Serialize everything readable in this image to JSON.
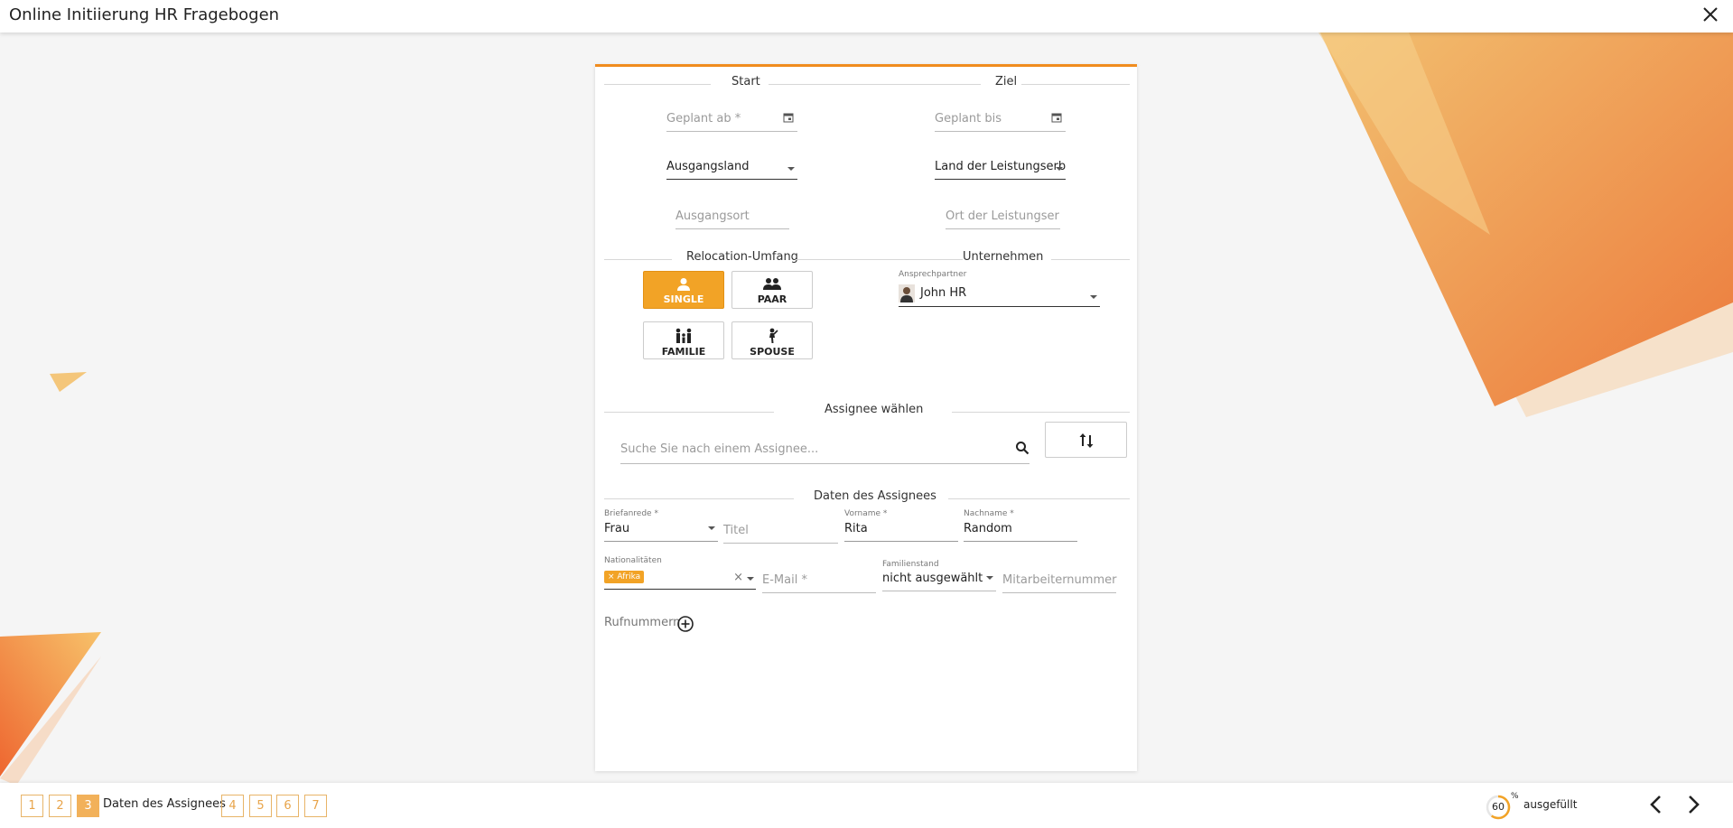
{
  "window": {
    "title": "Online Initiierung HR Fragebogen"
  },
  "sections": {
    "start": "Start",
    "ziel": "Ziel",
    "relocation": "Relocation-Umfang",
    "unternehmen": "Unternehmen",
    "assignee_select": "Assignee wählen",
    "assignee_data": "Daten des Assignees"
  },
  "start": {
    "planned_from": "Geplant ab *",
    "origin_country": "Ausgangsland",
    "origin_place": "Ausgangsort"
  },
  "ziel": {
    "planned_to": "Geplant bis",
    "service_country": "Land der Leistungserbringung",
    "service_place": "Ort der Leistungserb..."
  },
  "scope": {
    "options": [
      "SINGLE",
      "PAAR",
      "FAMILIE",
      "SPOUSE"
    ],
    "selected": "SINGLE"
  },
  "company": {
    "contact_label": "Ansprechpartner",
    "contact_value": "John HR"
  },
  "search": {
    "placeholder": "Suche Sie nach einem Assignee..."
  },
  "assignee": {
    "salutation_label": "Briefanrede *",
    "salutation_value": "Frau",
    "title_placeholder": "Titel",
    "firstname_label": "Vorname *",
    "firstname_value": "Rita",
    "lastname_label": "Nachname *",
    "lastname_value": "Random",
    "nationality_label": "Nationalitäten",
    "nationality_chip": "Afrika",
    "email_placeholder": "E-Mail *",
    "marital_label": "Familienstand",
    "marital_value": "nicht ausgewählt",
    "employee_placeholder": "Mitarbeiternummer",
    "phones_label": "Rufnummern"
  },
  "footer": {
    "steps": [
      "1",
      "2",
      "3",
      "4",
      "5",
      "6",
      "7"
    ],
    "active_step": "3",
    "active_step_label": "Daten des Assignees",
    "progress_value": "60",
    "progress_unit": "%",
    "progress_text": "ausgefüllt",
    "progress_fraction": 0.6
  },
  "colors": {
    "accent": "#f08c1e",
    "button_active": "#f2a326",
    "deco_light": "#f7c47a",
    "deco_dark": "#ee8a4a"
  },
  "icons": {
    "close": "close-icon",
    "calendar": "calendar-icon",
    "search": "search-icon",
    "swap": "swap-vertical-icon",
    "add": "add-circle-icon",
    "prev": "chevron-left-icon",
    "next": "chevron-right-icon"
  }
}
